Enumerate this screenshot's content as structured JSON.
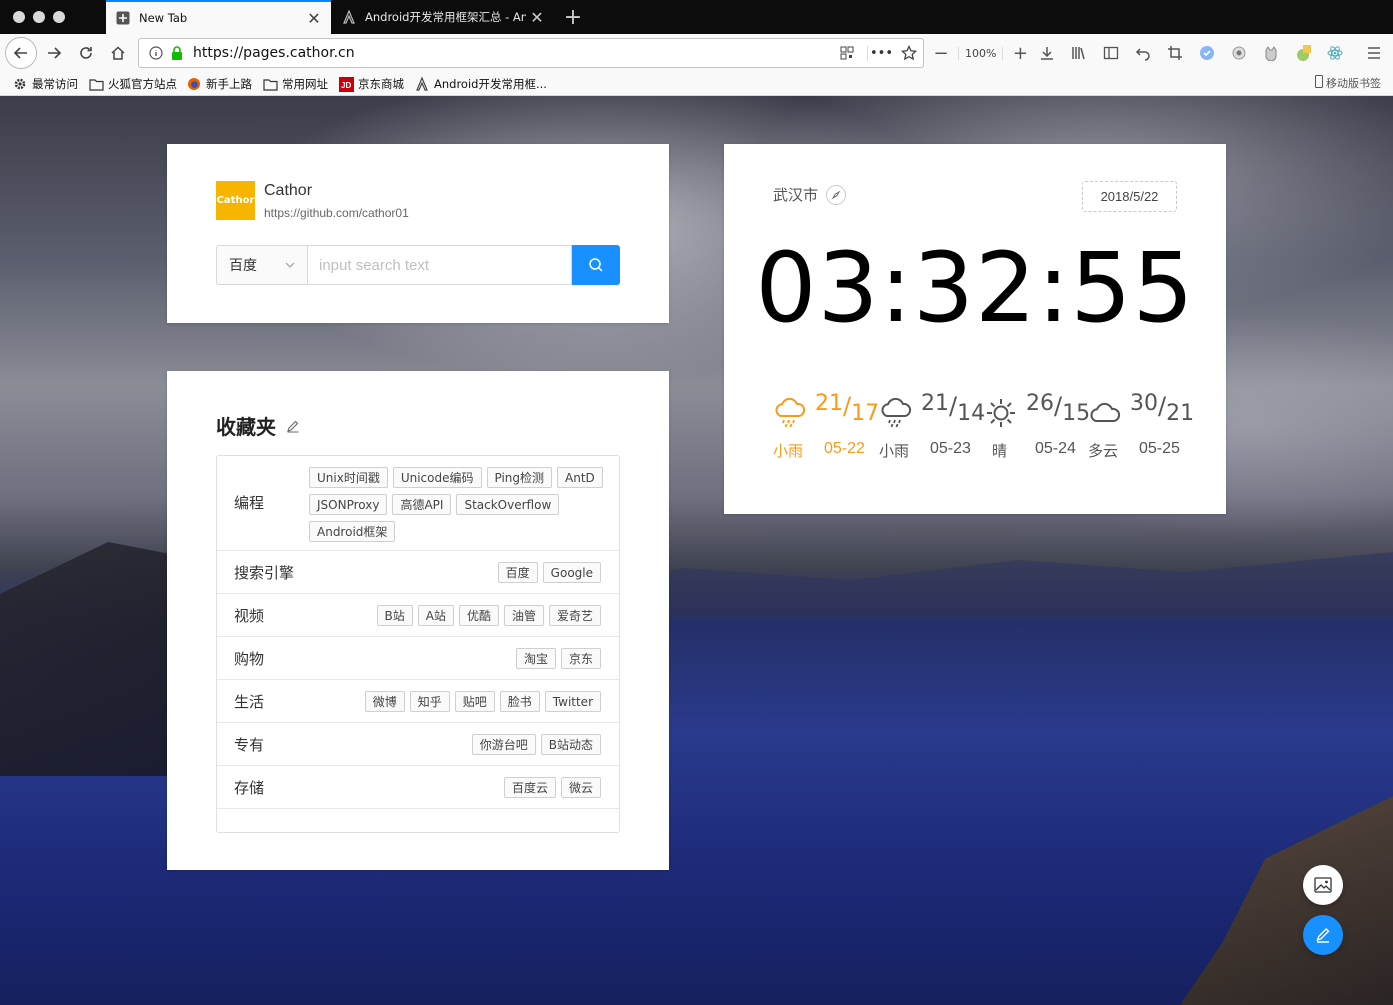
{
  "browser": {
    "tabs": [
      {
        "title": "New Tab",
        "active": true
      },
      {
        "title": "Android开发常用框架汇总 - Angu",
        "active": false
      }
    ],
    "url": "https://pages.cathor.cn",
    "zoom": "100%",
    "bookmarks": [
      {
        "label": "最常访问",
        "icon": "gear-icon"
      },
      {
        "label": "火狐官方站点",
        "icon": "folder-icon"
      },
      {
        "label": "新手上路",
        "icon": "firefox-icon"
      },
      {
        "label": "常用网址",
        "icon": "folder-icon"
      },
      {
        "label": "京东商城",
        "icon": "jd-icon"
      },
      {
        "label": "Android开发常用框...",
        "icon": "angular-icon"
      }
    ],
    "mobile_bookmarks": "移动版书签"
  },
  "profile": {
    "avatar_text": "Cathor",
    "name": "Cathor",
    "url": "https://github.com/cathor01"
  },
  "search": {
    "engine": "百度",
    "placeholder": "input search text"
  },
  "favorites": {
    "title": "收藏夹",
    "rows": [
      {
        "category": "编程",
        "tags": [
          "Unix时间戳",
          "Unicode编码",
          "Ping检测",
          "AntD",
          "JSONProxy",
          "高德API",
          "StackOverflow",
          "Android框架"
        ]
      },
      {
        "category": "搜索引擎",
        "tags": [
          "百度",
          "Google"
        ]
      },
      {
        "category": "视频",
        "tags": [
          "B站",
          "A站",
          "优酷",
          "油管",
          "爱奇艺"
        ]
      },
      {
        "category": "购物",
        "tags": [
          "淘宝",
          "京东"
        ]
      },
      {
        "category": "生活",
        "tags": [
          "微博",
          "知乎",
          "贴吧",
          "脸书",
          "Twitter"
        ]
      },
      {
        "category": "专有",
        "tags": [
          "你游台吧",
          "B站动态"
        ]
      },
      {
        "category": "存储",
        "tags": [
          "百度云",
          "微云"
        ]
      }
    ]
  },
  "weather": {
    "city": "武汉市",
    "date": "2018/5/22",
    "time": "03:32:55",
    "forecast": [
      {
        "high": "21",
        "low": "17",
        "condition": "小雨",
        "date": "05-22",
        "icon": "rain-icon",
        "today": true
      },
      {
        "high": "21",
        "low": "14",
        "condition": "小雨",
        "date": "05-23",
        "icon": "rain-icon",
        "today": false
      },
      {
        "high": "26",
        "low": "15",
        "condition": "晴",
        "date": "05-24",
        "icon": "sun-icon",
        "today": false
      },
      {
        "high": "30",
        "low": "21",
        "condition": "多云",
        "date": "05-25",
        "icon": "cloud-icon",
        "today": false
      }
    ],
    "accent_color": "#fa9a1a"
  },
  "colors": {
    "primary": "#1890ff",
    "avatar_bg": "#f7b500"
  }
}
